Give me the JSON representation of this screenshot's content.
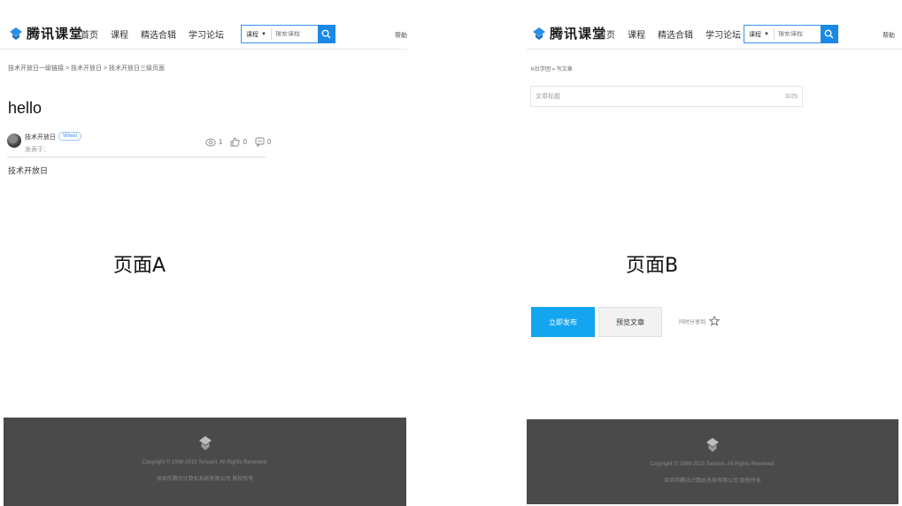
{
  "header": {
    "logo_text": "腾讯课堂",
    "nav": [
      "首页",
      "课程",
      "精选合辑",
      "学习论坛"
    ],
    "search_select": "课程",
    "search_placeholder": "搜索课程",
    "help": "帮助"
  },
  "page_a": {
    "breadcrumb": [
      "技术开放日一级链接",
      "技术开放日",
      "技术开放日三级页面"
    ],
    "breadcrumb_sep": ">",
    "post_title": "hello",
    "author": "技术开放日",
    "badge": "Wiwei",
    "published": "发表于：",
    "stats": {
      "views": "1",
      "likes": "0",
      "comments": "0"
    },
    "body": "技术开放日",
    "label": "页面A"
  },
  "page_b": {
    "breadcrumb": [
      "K社学团",
      "写文章"
    ],
    "breadcrumb_sep": "»",
    "title_placeholder": "文章标题",
    "title_counter": "0/25",
    "publish_btn": "立即发布",
    "preview_btn": "预览文章",
    "share_label": "同时分享到",
    "label": "页面B"
  },
  "footer": {
    "copyright": "Copyright © 1998-2015 Tencent. All Rights Reserved.",
    "icp": "深圳市腾讯计算机系统有限公司 版权所有"
  },
  "colors": {
    "accent_blue": "#1a89e6",
    "publish_blue": "#13a5ef",
    "footer_bg": "#4a4a4a"
  }
}
